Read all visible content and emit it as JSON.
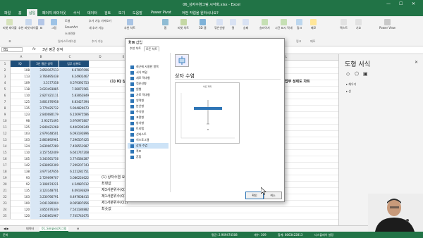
{
  "window": {
    "title": "06_상자수염그림 시각화.xlsx - Excel",
    "minimize": "—",
    "maximize": "☐",
    "close": "✕"
  },
  "ribbon_tabs": [
    "파일",
    "홈",
    "삽입",
    "페이지 레이아웃",
    "수식",
    "데이터",
    "검토",
    "보기",
    "도움말",
    "Power Pivot"
  ],
  "active_tab": "삽입",
  "tell_me": "어떤 작업을 원하시나요?",
  "ribbon": {
    "buttons": [
      "피벗 테이블",
      "추천 피벗 테이블",
      "표",
      "그림",
      "도형",
      "SmartArt",
      "스크린샷",
      "추가 기능 가져오기",
      "내 추가 기능",
      "추천 차트",
      "맵",
      "피벗 차트",
      "3D 맵",
      "꺾은선형",
      "열",
      "승패",
      "슬라이서",
      "시간 표시 막대",
      "링크",
      "메모",
      "텍스트",
      "기호"
    ],
    "groups": [
      "표",
      "일러스트레이션",
      "추가 기능",
      "차트",
      "투어",
      "스파크라인",
      "필터",
      "링크",
      "메모",
      "Power View"
    ],
    "power_view": "Power View"
  },
  "formula_bar": {
    "cell": "B1",
    "fx": "fx",
    "content": "3년 평균 성적"
  },
  "sheet": {
    "columns": [
      "A",
      "B",
      "C",
      "D",
      "E",
      "F",
      "G",
      "H",
      "I",
      "J",
      "K",
      "L"
    ],
    "header": [
      "IQ",
      "3년 평균 성적",
      "업무 성취도"
    ],
    "rows": [
      [
        "108",
        "3.850167513",
        "6.67097096"
      ],
      [
        "113",
        "3.766695438",
        "6.24902467"
      ],
      [
        "109",
        "3.5177358",
        "6.579392753"
      ],
      [
        "118",
        "3.023493885",
        "7.58071561"
      ],
      [
        "110",
        "2.827421111",
        "5.83062849"
      ],
      [
        "125",
        "3.801076958",
        "6.83427394"
      ],
      [
        "135",
        "3.779425732",
        "5.904820673"
      ],
      [
        "123",
        "2.840080179",
        "6.156975586"
      ],
      [
        "98",
        "2.93271495",
        "5.976975807"
      ],
      [
        "125",
        "2.840421268",
        "6.400290249"
      ],
      [
        "103",
        "2.979148501",
        "6.093192896"
      ],
      [
        "103",
        "2.863892961",
        "7.296507425"
      ],
      [
        "124",
        "3.839067289",
        "7.458551987"
      ],
      [
        "110",
        "3.157542409",
        "6.601747208"
      ],
      [
        "105",
        "3.343561756",
        "5.774584287"
      ],
      [
        "142",
        "2.838092309",
        "7.299207743"
      ],
      [
        "138",
        "3.977347656",
        "6.151281751"
      ],
      [
        "93",
        "2.729099707",
        "5.086224622"
      ],
      [
        "92",
        "3.108074221",
        "4.54987012"
      ],
      [
        "135",
        "3.123148701",
        "6.09193829"
      ],
      [
        "103",
        "3.230766791",
        "6.497608415"
      ],
      [
        "100",
        "3.041180004",
        "8.065897856"
      ],
      [
        "120",
        "3.855076349",
        "7.541184882"
      ],
      [
        "120",
        "2.045661967",
        "7.745743675"
      ]
    ],
    "side_title": "(1) IQ 상",
    "side_title_right": "업무 성취도 차트",
    "side_notes": [
      "(1) 상자수염 요약",
      "최댓값",
      "제3사분위수(Q3)",
      "제1사분위수(Q1)",
      "제1사분위수(Q1)",
      "최솟값"
    ]
  },
  "dialog": {
    "title": "차트 삽입",
    "close": "?  ✕",
    "tabs": [
      "추천 차트",
      "모든 차트"
    ],
    "categories": [
      "최근에 사용한 항목",
      "서식 파일",
      "세로 막대형",
      "꺾은선형",
      "원형",
      "가로 막대형",
      "영역형",
      "분산형",
      "주식형",
      "표면형",
      "방사형",
      "트리맵",
      "선버스트",
      "히스토그램",
      "상자 수염",
      "폭포",
      "혼합"
    ],
    "selected_category": "상자 수염",
    "section_title": "상자 수염",
    "preview_title": "차트 제목",
    "ok": "확인",
    "cancel": "취소"
  },
  "pane": {
    "title": "도형 서식",
    "items": [
      "채우기",
      "선"
    ]
  },
  "sheet_tabs": [
    "데이터",
    "01_Simple상자그림"
  ],
  "active_sheet": "01_Simple상자그림",
  "status": {
    "mode": "준비",
    "average": "평균: 2.969474508",
    "count": "개수: 309",
    "sum": "합계: 8063422813",
    "display": "디스플레이 설정"
  },
  "colors": {
    "excel_green": "#217346",
    "header_blue": "#1f4e79",
    "selected_blue": "#cde3f7"
  }
}
